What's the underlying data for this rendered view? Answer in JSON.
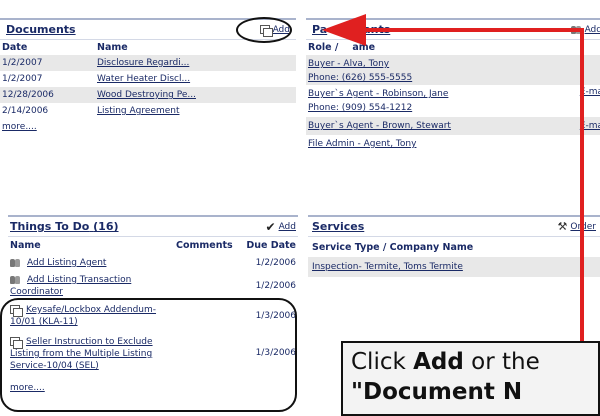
{
  "documents": {
    "title": "Documents",
    "add_label": "Add",
    "col_date": "Date",
    "col_name": "Name",
    "rows": [
      {
        "date": "1/2/2007",
        "name": "Disclosure Regardi..."
      },
      {
        "date": "1/2/2007",
        "name": "Water Heater Discl..."
      },
      {
        "date": "12/28/2006",
        "name": "Wood Destroying Pe..."
      },
      {
        "date": "2/14/2006",
        "name": "Listing Agreement"
      }
    ],
    "more": "more...."
  },
  "participants": {
    "title_part1": "Pa",
    "title_part2": "ants",
    "add_label": "Add",
    "col_role_a": "Role /",
    "col_role_b": "ame",
    "items": [
      {
        "line1": "Buyer - Alva, Tony",
        "line2": "Phone: (626) 555-5555",
        "email": ""
      },
      {
        "line1": "Buyer`s Agent - Robinson, Jane",
        "line2": "Phone: (909) 554-1212",
        "email": "E-mail"
      },
      {
        "line1": "Buyer`s Agent - Brown, Stewart",
        "line2": "",
        "email": "E-mail"
      },
      {
        "line1": "File Admin - Agent, Tony",
        "line2": "",
        "email": ""
      }
    ]
  },
  "todo": {
    "title": "Things To Do",
    "count": "(16)",
    "add_label": "Add",
    "col_name": "Name",
    "col_comments": "Comments",
    "col_due": "Due Date",
    "rows": [
      {
        "line1": "Add Listing Agent",
        "line2": "",
        "line3": "",
        "due": "1/2/2006",
        "icon": "people-icon"
      },
      {
        "line1": "Add Listing Transaction",
        "line2": "Coordinator",
        "line3": "",
        "due": "1/2/2006",
        "icon": "people-icon"
      },
      {
        "line1": "Keysafe/Lockbox Addendum-",
        "line2": "10/01 (KLA-11)",
        "line3": "",
        "due": "1/3/2006",
        "icon": "document-icon"
      },
      {
        "line1": "Seller Instruction to Exclude",
        "line2": "Listing from the Multiple Listing",
        "line3": "Service-10/04 (SEL)",
        "due": "1/3/2006",
        "icon": "document-icon"
      }
    ],
    "more": "more...."
  },
  "services": {
    "title": "Services",
    "order_label": "Order",
    "col_header": "Service Type / Company Name",
    "rows": [
      {
        "name": "Inspection- Termite, Toms Termite"
      }
    ]
  },
  "callout": {
    "line1_pre": "Click ",
    "line1_bold": "Add",
    "line1_post": " or the",
    "line2": "\"Document N"
  },
  "colors": {
    "accent_red": "#e02020",
    "link_navy": "#1a2a66",
    "row_alt": "#e8e8e8"
  }
}
